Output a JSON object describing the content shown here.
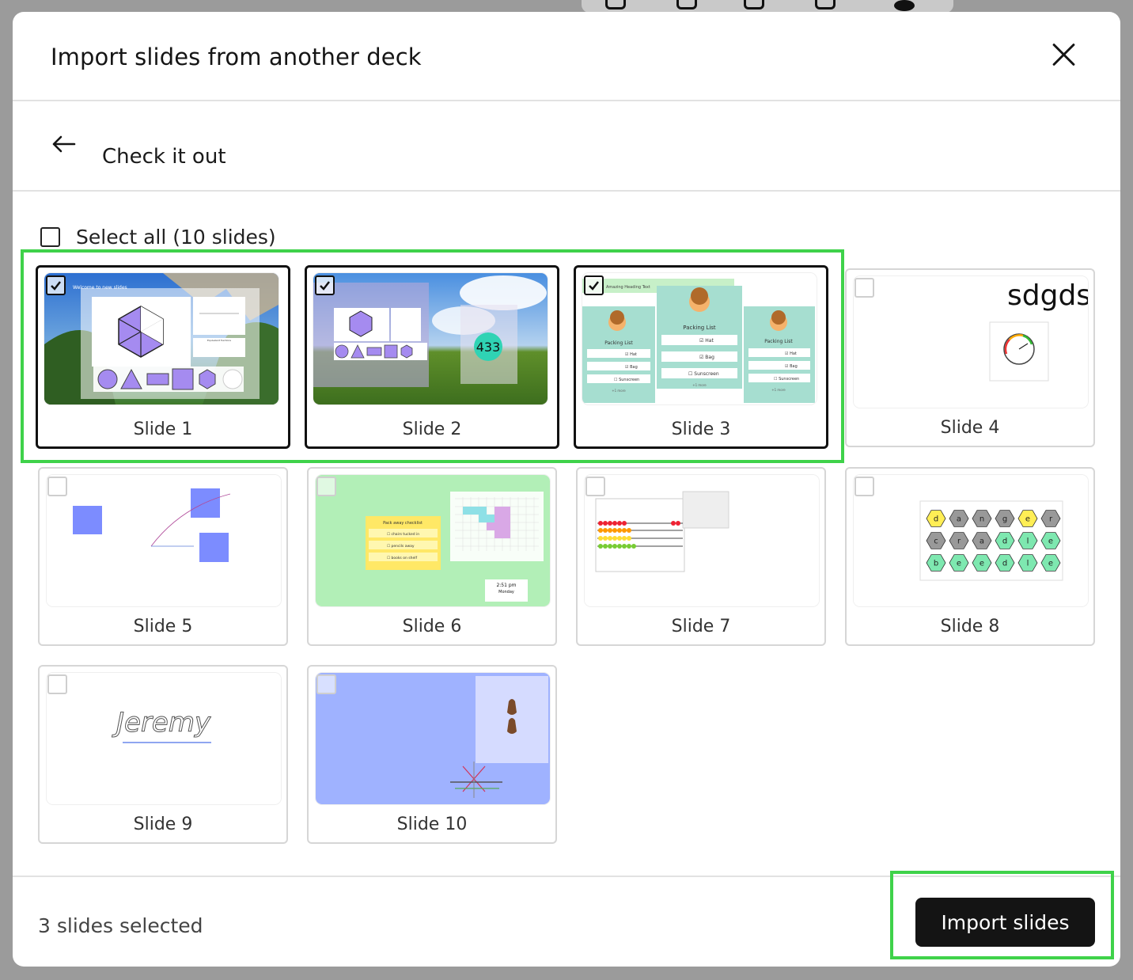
{
  "modal": {
    "title": "Import slides from another deck",
    "deck_name": "Check it out",
    "select_all_label": "Select all (10 slides)",
    "selected_status": "3 slides selected",
    "import_button_label": "Import slides"
  },
  "slides": [
    {
      "label": "Slide 1",
      "checked": true
    },
    {
      "label": "Slide 2",
      "checked": true
    },
    {
      "label": "Slide 3",
      "checked": true
    },
    {
      "label": "Slide 4",
      "checked": false
    },
    {
      "label": "Slide 5",
      "checked": false
    },
    {
      "label": "Slide 6",
      "checked": false
    },
    {
      "label": "Slide 7",
      "checked": false
    },
    {
      "label": "Slide 8",
      "checked": false
    },
    {
      "label": "Slide 9",
      "checked": false
    },
    {
      "label": "Slide 10",
      "checked": false
    }
  ],
  "thumb_text": {
    "s1_title": "Welcome to new slides",
    "s1_frac_label": "Equivalent fractions",
    "s2_counter": "433",
    "s3_heading": "Amazing Heading Text",
    "s3_packing_list": "Packing List",
    "s3_item_hat": "☑ Hat",
    "s3_item_bag": "☑ Bag",
    "s3_item_sunscreen": "☐ Sunscreen",
    "s3_more": "+1 more",
    "s4_text": "sdgds",
    "s6_checklist_title": "Pack away checklist",
    "s6_item1": "☐ chairs tucked in",
    "s6_item2": "☐ pencils away",
    "s6_item3": "☐ books on shelf",
    "s6_time": "2:51 pm",
    "s6_day": "Monday",
    "s8_hex_row1": [
      "d",
      "a",
      "n",
      "g",
      "e",
      "r"
    ],
    "s8_hex_row2": [
      "c",
      "r",
      "a",
      "d",
      "l",
      "e"
    ],
    "s8_hex_row3": [
      "b",
      "e",
      "e",
      "d",
      "l",
      "e"
    ],
    "s9_signature": "Jeremy"
  },
  "colors": {
    "highlight": "#3fd24a",
    "button_bg": "#141414",
    "slide5_blue": "#7c8cff",
    "slide10_bg": "#9fb2ff",
    "slide6_bg": "#b2efb7",
    "slide3_bg": "#a6ded0"
  }
}
